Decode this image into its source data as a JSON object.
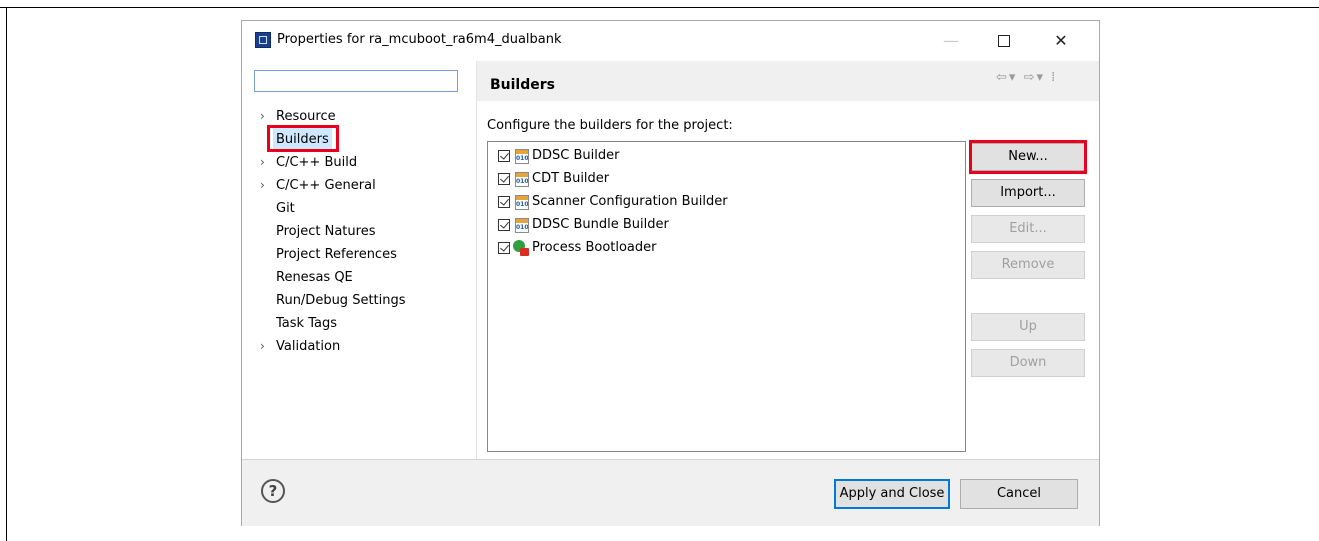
{
  "window": {
    "title": "Properties for ra_mcuboot_ra6m4_dualbank",
    "minimize_glyph": "—",
    "close_glyph": "✕"
  },
  "filter": {
    "value": "",
    "placeholder": ""
  },
  "tree": {
    "items": [
      {
        "label": "Resource",
        "expandable": true,
        "selected": false
      },
      {
        "label": "Builders",
        "expandable": false,
        "selected": true
      },
      {
        "label": "C/C++ Build",
        "expandable": true,
        "selected": false
      },
      {
        "label": "C/C++ General",
        "expandable": true,
        "selected": false
      },
      {
        "label": "Git",
        "expandable": false,
        "selected": false
      },
      {
        "label": "Project Natures",
        "expandable": false,
        "selected": false
      },
      {
        "label": "Project References",
        "expandable": false,
        "selected": false
      },
      {
        "label": "Renesas QE",
        "expandable": false,
        "selected": false
      },
      {
        "label": "Run/Debug Settings",
        "expandable": false,
        "selected": false
      },
      {
        "label": "Task Tags",
        "expandable": false,
        "selected": false
      },
      {
        "label": "Validation",
        "expandable": true,
        "selected": false
      }
    ]
  },
  "page": {
    "title": "Builders",
    "description": "Configure the builders for the project:",
    "nav_icons": [
      "back-arrow-icon",
      "dropdown-icon",
      "forward-arrow-icon",
      "dropdown-icon",
      "view-menu-icon"
    ]
  },
  "builders": [
    {
      "label": "DDSC Builder",
      "checked": true,
      "icon": "binary-builder-icon"
    },
    {
      "label": "CDT Builder",
      "checked": true,
      "icon": "binary-builder-icon"
    },
    {
      "label": "Scanner Configuration Builder",
      "checked": true,
      "icon": "binary-builder-icon"
    },
    {
      "label": "DDSC Bundle Builder",
      "checked": true,
      "icon": "binary-builder-icon"
    },
    {
      "label": "Process Bootloader",
      "checked": true,
      "icon": "external-tool-builder-icon"
    }
  ],
  "builder_icon_text": "010",
  "buttons": {
    "new": {
      "label": "New...",
      "enabled": true,
      "highlighted": true
    },
    "import": {
      "label": "Import...",
      "enabled": true
    },
    "edit": {
      "label": "Edit...",
      "enabled": false
    },
    "remove": {
      "label": "Remove",
      "enabled": false
    },
    "up": {
      "label": "Up",
      "enabled": false
    },
    "down": {
      "label": "Down",
      "enabled": false
    }
  },
  "footer": {
    "help_glyph": "?",
    "apply_label": "Apply and Close",
    "cancel_label": "Cancel"
  },
  "colors": {
    "highlight_box": "#e8001c",
    "focus_border": "#0078d7",
    "selection_bg": "#cde8ff"
  }
}
